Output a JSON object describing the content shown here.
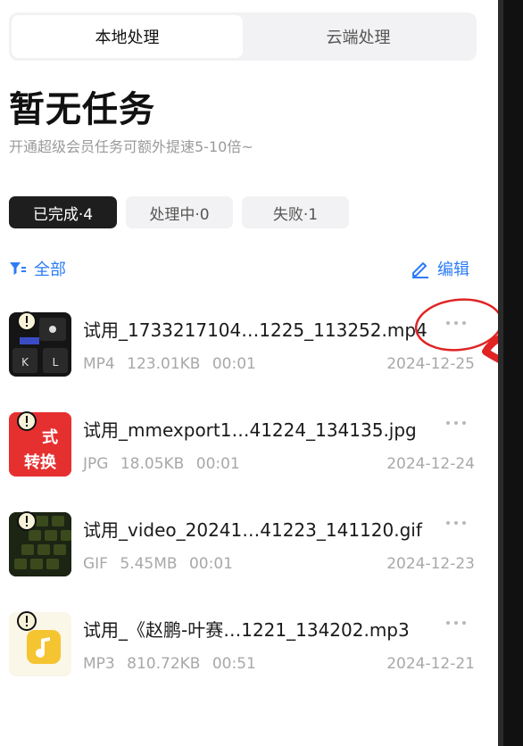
{
  "tabs": {
    "local": "本地处理",
    "cloud": "云端处理",
    "active": "local"
  },
  "header": {
    "title": "暂无任务",
    "subtitle": "开通超级会员任务可额外提速5-10倍~"
  },
  "filters": [
    {
      "label": "已完成·4",
      "selected": true
    },
    {
      "label": "处理中·0",
      "selected": false
    },
    {
      "label": "失败·1",
      "selected": false
    }
  ],
  "toolbar": {
    "filter_label": "全部",
    "edit_label": "编辑"
  },
  "tasks": [
    {
      "name": "试用_1733217104…1225_113252.mp4",
      "type": "MP4",
      "size": "123.01KB",
      "duration": "00:01",
      "date": "2024-12-25",
      "thumb_text": ""
    },
    {
      "name": "试用_mmexport1…41224_134135.jpg",
      "type": "JPG",
      "size": "18.05KB",
      "duration": "00:01",
      "date": "2024-12-24",
      "thumb_text": "转换"
    },
    {
      "name": "试用_video_20241…41223_141120.gif",
      "type": "GIF",
      "size": "5.45MB",
      "duration": "00:01",
      "date": "2024-12-23",
      "thumb_text": ""
    },
    {
      "name": "试用_《赵鹏-叶赛…1221_134202.mp3",
      "type": "MP3",
      "size": "810.72KB",
      "duration": "00:51",
      "date": "2024-12-21",
      "thumb_text": ""
    }
  ],
  "colors": {
    "accent": "#2d7cf6",
    "annotation": "#e02424",
    "chip_selected": "#1e1e1e"
  }
}
